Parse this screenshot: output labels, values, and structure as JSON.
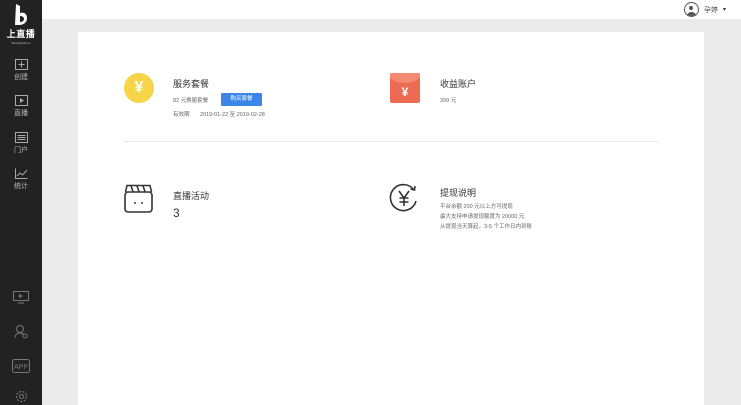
{
  "sidebar": {
    "logo_text": "上直播",
    "logo_sub": "Shangzhibo.tv",
    "nav": [
      {
        "label": "创建",
        "icon": "plus-square-icon"
      },
      {
        "label": "直播",
        "icon": "play-square-icon"
      },
      {
        "label": "门户",
        "icon": "portal-icon"
      },
      {
        "label": "统计",
        "icon": "line-chart-icon"
      }
    ],
    "bottom_icons": [
      "screen-icon",
      "user-search-icon",
      "app-icon",
      "settings-icon"
    ],
    "bottom_app_label": "APP"
  },
  "header": {
    "username": "孕婷",
    "caret": "▾"
  },
  "cards": {
    "service": {
      "title": "服务套餐",
      "plan": "82 元换届套餐",
      "buy_label": "购买套餐",
      "validity_label": "有效期",
      "validity_range": "2019-01-22 至 2019-02-28",
      "icon_symbol": "¥"
    },
    "income": {
      "title": "收益账户",
      "amount": "399 元",
      "icon_symbol": "¥"
    },
    "live": {
      "title": "直播活动",
      "count": "3"
    },
    "withdraw": {
      "title": "提现说明",
      "lines": [
        "平台余额 200 元以上方可提现",
        "最大支持申请提现额度为 20000 元",
        "从提现当天算起，3-5 个工作日内到账"
      ]
    }
  },
  "colors": {
    "sidebar_bg": "#222222",
    "accent_blue": "#3b86e6",
    "yen_yellow": "#f5d547",
    "envelope_red": "#ec6b52"
  }
}
